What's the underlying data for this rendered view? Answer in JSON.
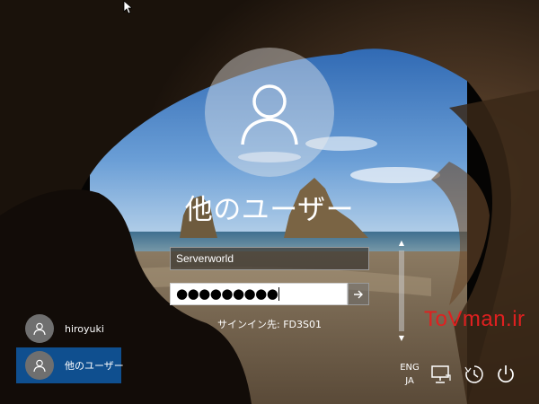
{
  "login": {
    "title": "他のユーザー",
    "username_value": "Serverworld",
    "password_mask": "●●●●●●●●●",
    "signin_to": "サインイン先: FD3S01"
  },
  "users": [
    {
      "name": "hiroyuki",
      "selected": false
    },
    {
      "name": "他のユーザー",
      "selected": true
    }
  ],
  "language": {
    "line1": "ENG",
    "line2": "JA"
  },
  "watermark": "ToVman.ir",
  "icons": {
    "user_avatar": "user-icon",
    "submit": "arrow-right-icon",
    "network": "network-icon",
    "ease_of_access": "ease-of-access-icon",
    "power": "power-icon"
  },
  "colors": {
    "selected_tile": "#0f4f8f",
    "watermark": "#e02020"
  }
}
